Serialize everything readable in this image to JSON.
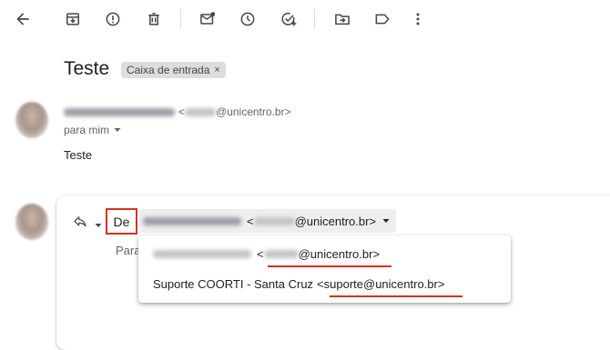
{
  "toolbar": {
    "items": [
      {
        "name": "back-arrow-icon"
      },
      {
        "name": "archive-icon"
      },
      {
        "name": "report-spam-icon"
      },
      {
        "name": "delete-icon"
      },
      {
        "name": "mark-unread-icon"
      },
      {
        "name": "snooze-icon"
      },
      {
        "name": "add-task-icon"
      },
      {
        "name": "move-to-icon"
      },
      {
        "name": "label-icon"
      },
      {
        "name": "more-vert-icon"
      }
    ]
  },
  "message": {
    "subject": "Teste",
    "label_chip": "Caixa de entrada",
    "label_chip_close": "×",
    "sender_open": "<",
    "sender_email_domain": "@unicentro.br>",
    "to_label": "para mim",
    "body": "Teste"
  },
  "reply": {
    "from_label": "De",
    "from_open": "<",
    "from_email_domain": "@unicentro.br>",
    "to_label": "Para",
    "options": [
      {
        "open": "<",
        "email_domain": "@unicentro.br>"
      },
      {
        "name": "Suporte COORTI - Santa Cruz",
        "email": "<suporte@unicentro.br>"
      }
    ]
  },
  "colors": {
    "highlight_red": "#d93025",
    "chip_bg": "#dddddd",
    "icon_gray": "#444746"
  }
}
